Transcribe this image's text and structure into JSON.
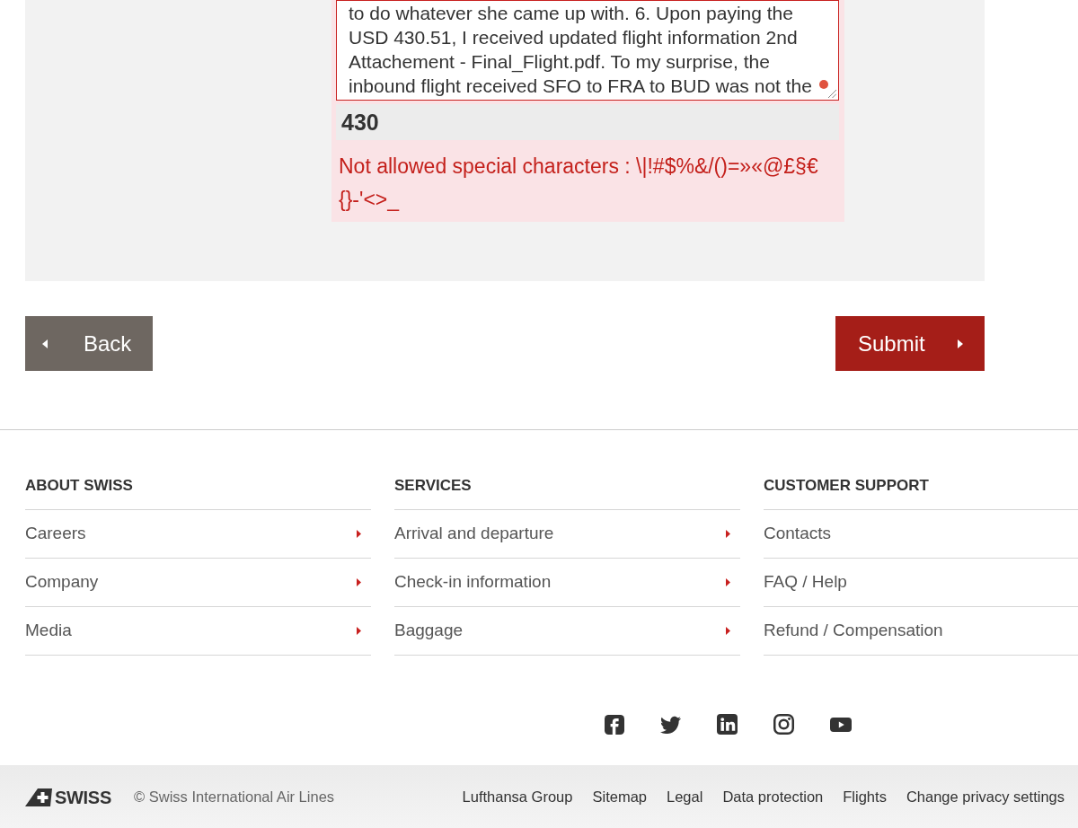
{
  "form": {
    "message_field": {
      "invalid": true,
      "value_lines": [
        "to do whatever she came up with. 6. Upon paying the",
        "USD 430.51, I received updated flight information 2nd",
        "Attachement - Final_Flight.pdf. To my surprise, the",
        "inbound flight received SFO to FRA to BUD was not the"
      ]
    },
    "character_count": "430",
    "error_message": "Not allowed special characters : \\|!#$%&/()=»«@£§€ {}-'<>_"
  },
  "buttons": [
    {
      "kind": "back",
      "label": "Back"
    },
    {
      "kind": "submit",
      "label": "Submit"
    }
  ],
  "footer": {
    "columns": [
      {
        "heading": "ABOUT SWISS",
        "arrows": true,
        "links": [
          "Careers",
          "Company",
          "Media"
        ]
      },
      {
        "heading": "SERVICES",
        "arrows": true,
        "links": [
          "Arrival and departure",
          "Check-in information",
          "Baggage"
        ]
      },
      {
        "heading": "CUSTOMER SUPPORT",
        "arrows": false,
        "links": [
          "Contacts",
          "FAQ / Help",
          "Refund / Compensation"
        ]
      }
    ],
    "social_links": [
      {
        "kind": "facebook"
      },
      {
        "kind": "twitter"
      },
      {
        "kind": "linkedin"
      },
      {
        "kind": "instagram"
      },
      {
        "kind": "youtube"
      }
    ],
    "bottom_bar": {
      "logo_text": "SWISS",
      "copyright": "© Swiss International Air Lines",
      "links": [
        "Lufthansa Group",
        "Sitemap",
        "Legal",
        "Data protection",
        "Flights",
        "Change privacy settings"
      ]
    }
  }
}
